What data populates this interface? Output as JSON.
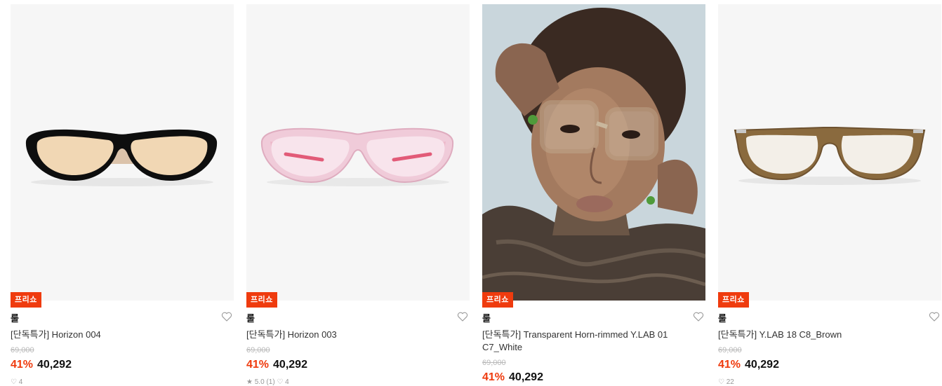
{
  "products": [
    {
      "badge": "프리쇼",
      "brand": "룰",
      "name": "[단독특가] Horizon 004",
      "original_price": "69,000",
      "discount": "41%",
      "price": "40,292",
      "meta": "♡ 4",
      "image": "black-frame-orange-lens-sunglasses"
    },
    {
      "badge": "프리쇼",
      "brand": "룰",
      "name": "[단독특가] Horizon 003",
      "original_price": "69,000",
      "discount": "41%",
      "price": "40,292",
      "meta": "★ 5.0 (1)  ♡ 4",
      "image": "clear-pink-sunglasses"
    },
    {
      "badge": "프리쇼",
      "brand": "룰",
      "name": "[단독특가] Transparent Horn-rimmed Y.LAB 01 C7_White",
      "original_price": "69,000",
      "discount": "41%",
      "price": "40,292",
      "image": "model-wearing-clear-glasses"
    },
    {
      "badge": "프리쇼",
      "brand": "룰",
      "name": "[단독특가] Y.LAB 18 C8_Brown",
      "original_price": "69,000",
      "discount": "41%",
      "price": "40,292",
      "meta": "♡ 22",
      "image": "brown-frame-eyeglasses"
    }
  ],
  "colors": {
    "accent": "#ef3b0e",
    "muted": "#b9b9b9"
  }
}
